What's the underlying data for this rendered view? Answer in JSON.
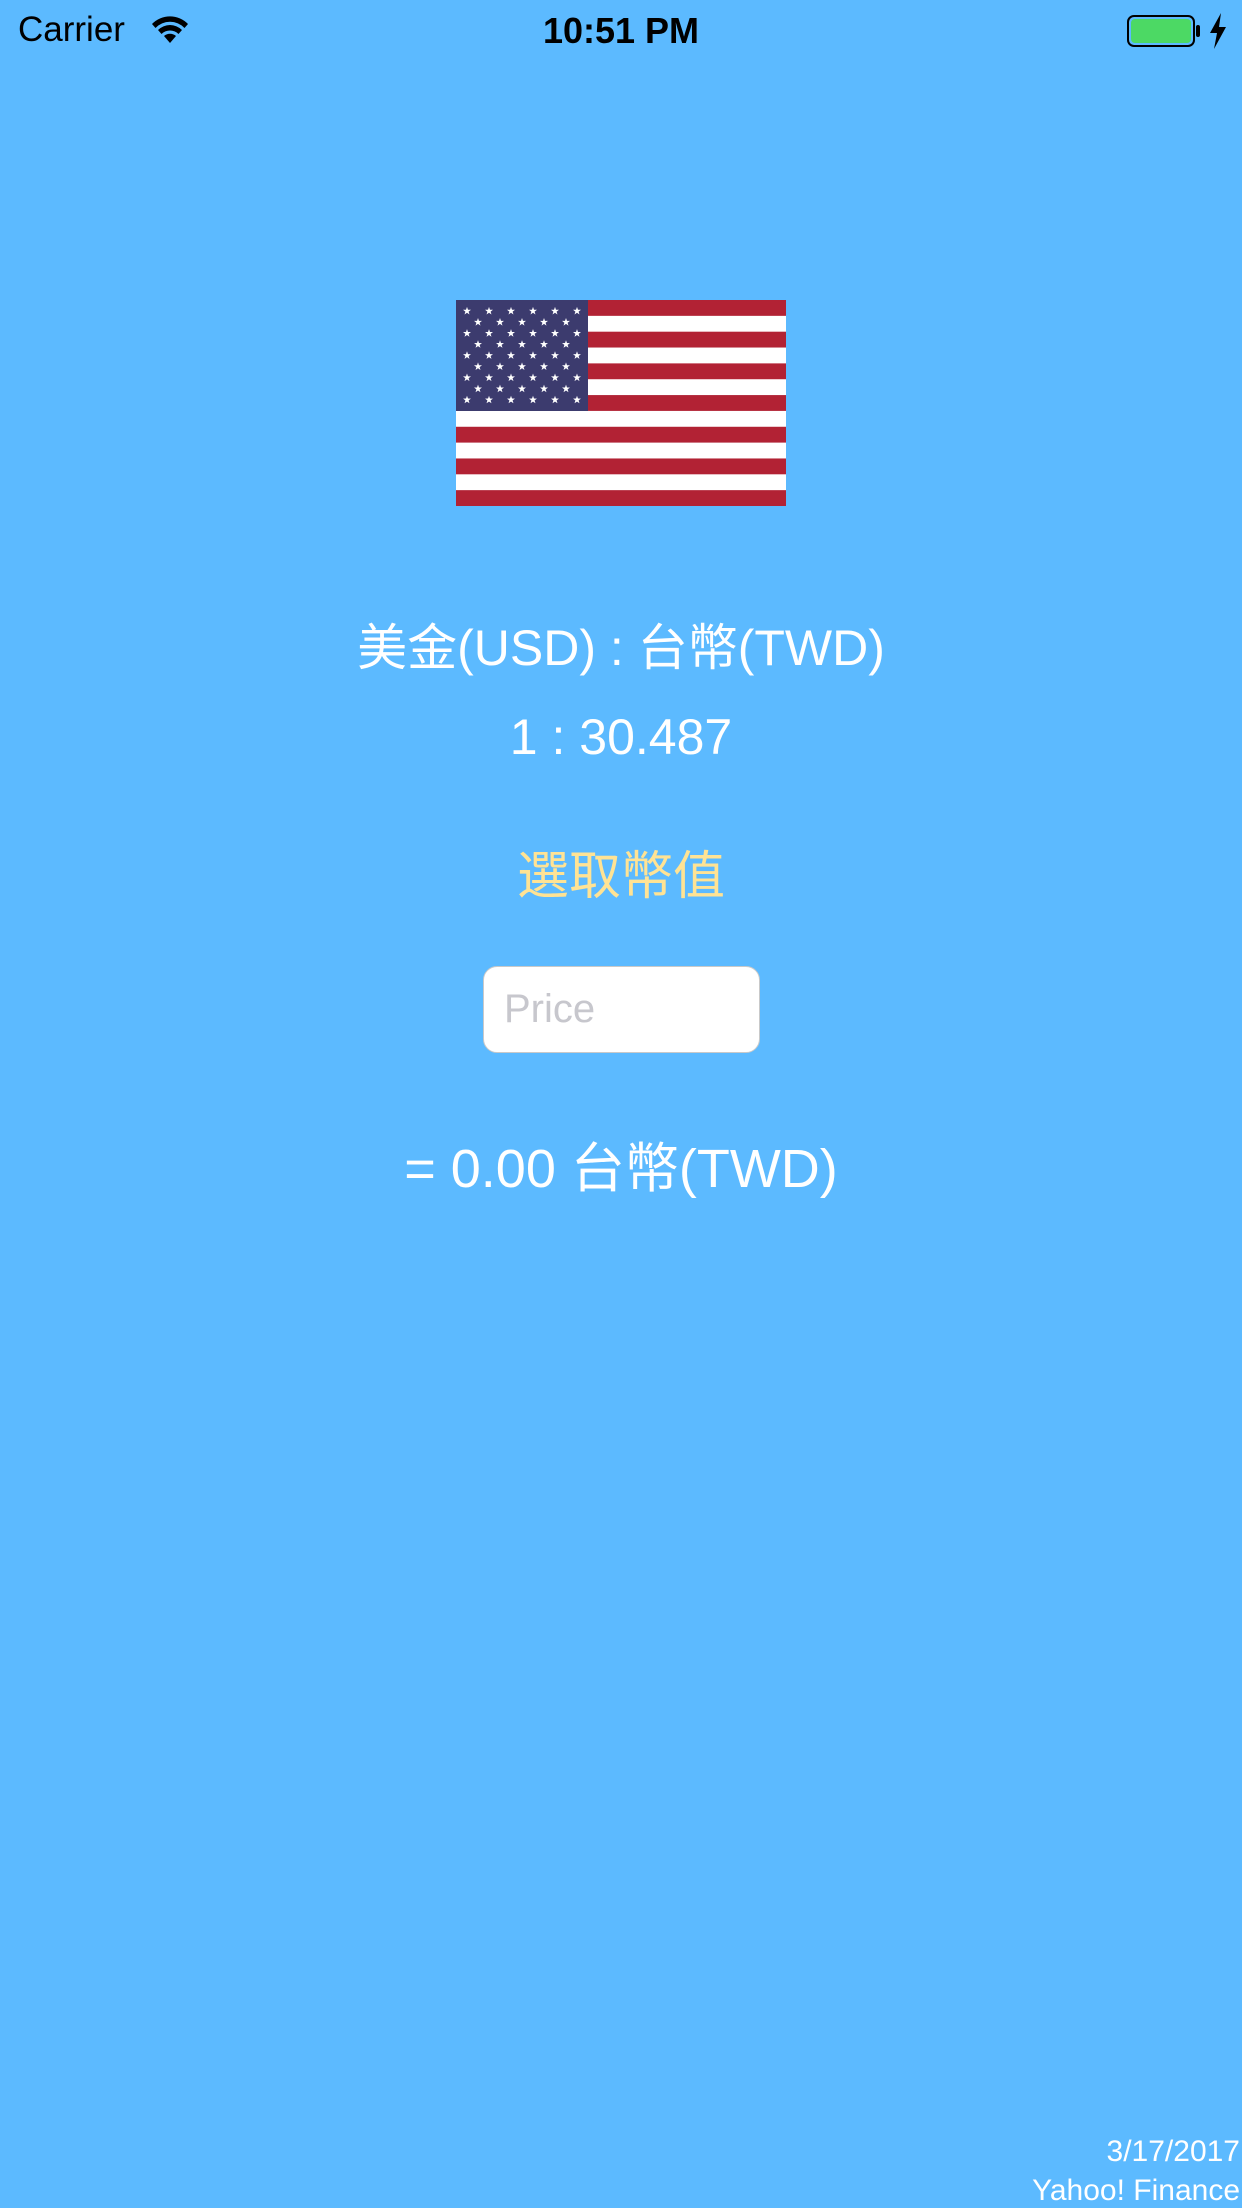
{
  "status_bar": {
    "carrier": "Carrier",
    "time": "10:51 PM",
    "battery_color": "#4cd964"
  },
  "icons": {
    "wifi": "wifi-icon",
    "battery": "battery-icon",
    "charging": "charging-bolt-icon",
    "flag": "us-flag-icon"
  },
  "colors": {
    "background": "#5cbaff",
    "text": "#ffffff",
    "accent": "#ffe394"
  },
  "converter": {
    "rate_title": "美金(USD) : 台幣(TWD)",
    "rate_value": "1 : 30.487",
    "pick_label": "選取幣值",
    "price_placeholder": "Price",
    "price_value": "",
    "result": "= 0.00 台幣(TWD)"
  },
  "footer": {
    "date": "3/17/2017",
    "source": "Yahoo! Finance"
  }
}
